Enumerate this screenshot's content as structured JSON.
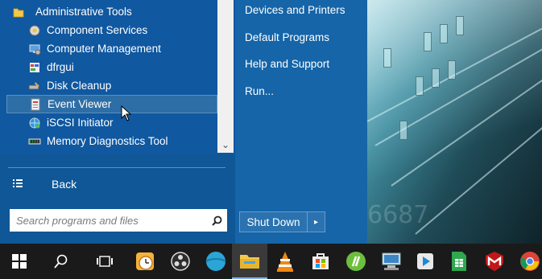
{
  "start_menu": {
    "programs": {
      "folder": {
        "label": "Administrative Tools",
        "icon": "folder-icon"
      },
      "items": [
        {
          "label": "Component Services",
          "icon": "component-services-icon"
        },
        {
          "label": "Computer Management",
          "icon": "computer-management-icon"
        },
        {
          "label": "dfrgui",
          "icon": "dfrgui-icon"
        },
        {
          "label": "Disk Cleanup",
          "icon": "disk-cleanup-icon"
        },
        {
          "label": "Event Viewer",
          "icon": "event-viewer-icon",
          "selected": true
        },
        {
          "label": "iSCSI Initiator",
          "icon": "iscsi-initiator-icon"
        },
        {
          "label": "Memory Diagnostics Tool",
          "icon": "memory-diagnostics-icon"
        }
      ]
    },
    "back_label": "Back",
    "search": {
      "placeholder": "Search programs and files"
    },
    "right_pane": {
      "items": [
        "Devices and Printers",
        "Default Programs",
        "Help and Support",
        "Run..."
      ]
    },
    "shutdown": {
      "label": "Shut Down"
    }
  },
  "taskbar": {
    "items": [
      {
        "name": "start-icon"
      },
      {
        "name": "search-icon"
      },
      {
        "name": "task-view-icon"
      },
      {
        "name": "clock-app-icon"
      },
      {
        "name": "obs-icon"
      },
      {
        "name": "globe-app-icon"
      },
      {
        "name": "file-explorer-icon",
        "active": true
      },
      {
        "name": "vlc-icon"
      },
      {
        "name": "store-icon"
      },
      {
        "name": "green-app-icon"
      },
      {
        "name": "computer-app-icon"
      },
      {
        "name": "media-player-icon"
      },
      {
        "name": "spreadsheet-icon"
      },
      {
        "name": "mcafee-icon"
      },
      {
        "name": "chrome-icon"
      }
    ]
  },
  "colors": {
    "menu_left": "#0f5796",
    "menu_right": "#1565a8",
    "taskbar": "#1a1a1a"
  }
}
